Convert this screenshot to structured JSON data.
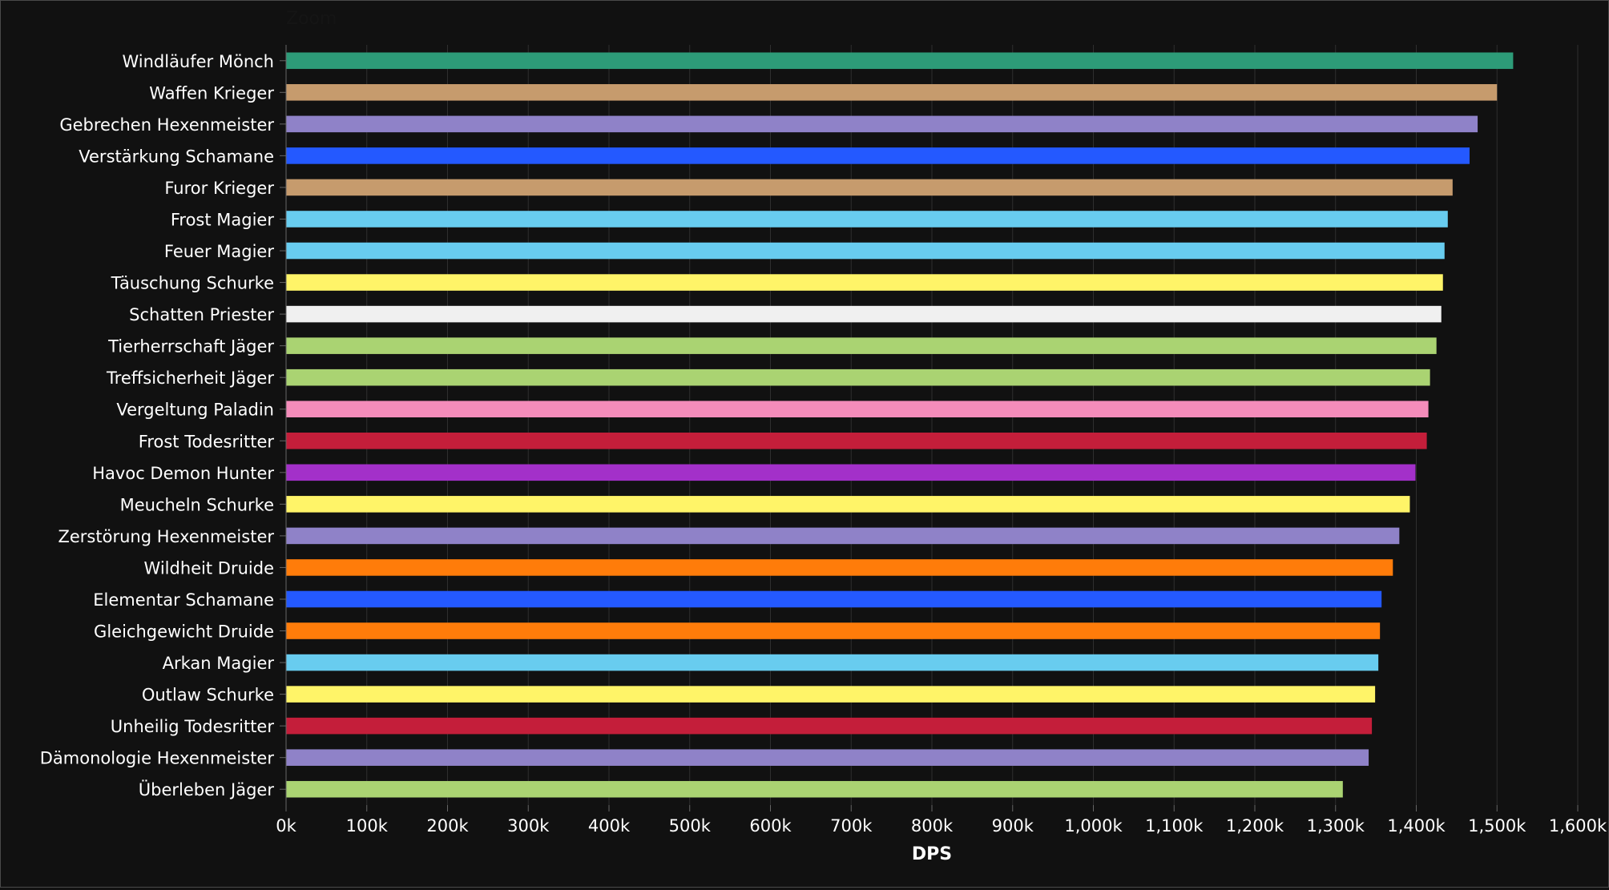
{
  "zoom_label": "Zoom",
  "chart_data": {
    "type": "bar",
    "orientation": "horizontal",
    "title": "",
    "xlabel": "DPS",
    "ylabel": "",
    "xlim": [
      0,
      1600000
    ],
    "x_ticks": [
      0,
      100000,
      200000,
      300000,
      400000,
      500000,
      600000,
      700000,
      800000,
      900000,
      1000000,
      1100000,
      1200000,
      1300000,
      1400000,
      1500000,
      1600000
    ],
    "x_tick_labels": [
      "0k",
      "100k",
      "200k",
      "300k",
      "400k",
      "500k",
      "600k",
      "700k",
      "800k",
      "900k",
      "1,000k",
      "1,100k",
      "1,200k",
      "1,300k",
      "1,400k",
      "1,500k",
      "1,600k"
    ],
    "grid": "vertical",
    "legend": "none",
    "categories": [
      "Windläufer Mönch",
      "Waffen Krieger",
      "Gebrechen Hexenmeister",
      "Verstärkung Schamane",
      "Furor Krieger",
      "Frost Magier",
      "Feuer Magier",
      "Täuschung Schurke",
      "Schatten Priester",
      "Tierherrschaft Jäger",
      "Treffsicherheit Jäger",
      "Vergeltung Paladin",
      "Frost Todesritter",
      "Havoc Demon Hunter",
      "Meucheln Schurke",
      "Zerstörung Hexenmeister",
      "Wildheit Druide",
      "Elementar Schamane",
      "Gleichgewicht Druide",
      "Arkan Magier",
      "Outlaw Schurke",
      "Unheilig Todesritter",
      "Dämonologie Hexenmeister",
      "Überleben Jäger"
    ],
    "values": [
      1520000,
      1500000,
      1476000,
      1466000,
      1445000,
      1439000,
      1435000,
      1433000,
      1431000,
      1425000,
      1417000,
      1415000,
      1413000,
      1399000,
      1392000,
      1379000,
      1371000,
      1357000,
      1355000,
      1353000,
      1349000,
      1345000,
      1341000,
      1309000
    ],
    "colors": [
      "#2d9b78",
      "#c69b6d",
      "#8f82c8",
      "#2459ff",
      "#c69b6d",
      "#68ccef",
      "#68ccef",
      "#fff468",
      "#f0f0f0",
      "#aad372",
      "#aad372",
      "#f48cba",
      "#c41e3a",
      "#a330c9",
      "#fff468",
      "#8f82c8",
      "#ff7c0a",
      "#2459ff",
      "#ff7c0a",
      "#68ccef",
      "#fff468",
      "#c41e3a",
      "#8f82c8",
      "#aad372"
    ]
  }
}
